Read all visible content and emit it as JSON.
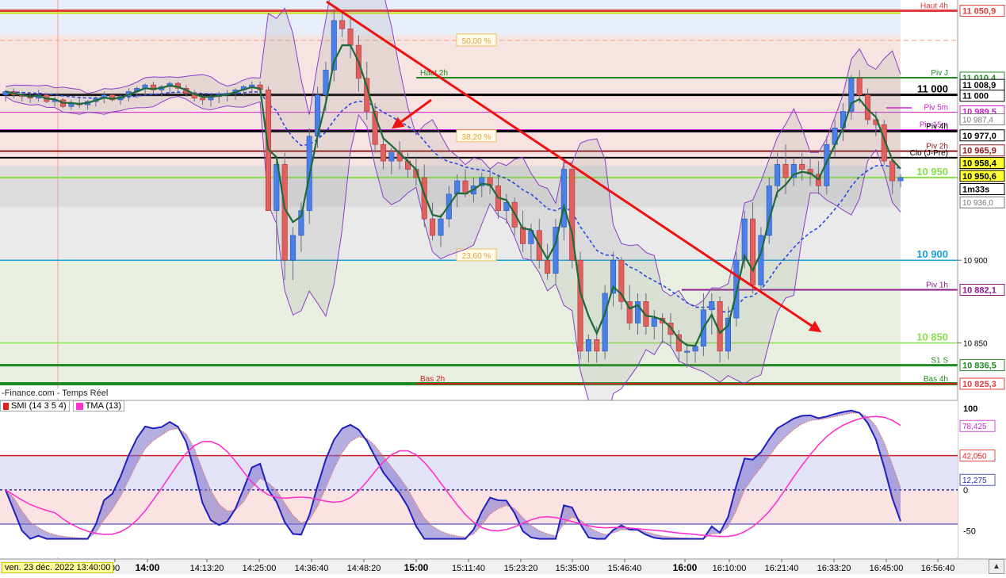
{
  "source_label": "-Finance.com - Temps Réel",
  "cursor_time": "ven. 23 déc. 2022 13:40:00",
  "price_axis_ticks": [
    {
      "value": 10900,
      "label": "10 900"
    },
    {
      "value": 10850,
      "label": "10 850"
    }
  ],
  "time_ticks": [
    {
      "label": "00",
      "bold": false
    },
    {
      "label": "14:00",
      "bold": true
    },
    {
      "label": "14:13:20",
      "bold": false
    },
    {
      "label": "14:25:00",
      "bold": false
    },
    {
      "label": "14:36:40",
      "bold": false
    },
    {
      "label": "14:48:20",
      "bold": false
    },
    {
      "label": "15:00",
      "bold": true
    },
    {
      "label": "15:11:40",
      "bold": false
    },
    {
      "label": "15:23:20",
      "bold": false
    },
    {
      "label": "15:35:00",
      "bold": false
    },
    {
      "label": "15:46:40",
      "bold": false
    },
    {
      "label": "16:00",
      "bold": true
    },
    {
      "label": "16:10:00",
      "bold": false
    },
    {
      "label": "16:21:40",
      "bold": false
    },
    {
      "label": "16:33:20",
      "bold": false
    },
    {
      "label": "16:45:00",
      "bold": false
    },
    {
      "label": "16:56:40",
      "bold": false
    }
  ],
  "levels": [
    {
      "name": "Haut 4h",
      "value": 11050.9,
      "badge": "11 050,9",
      "color": "#e23b3b",
      "inline": "Haut 4h"
    },
    {
      "name": "Piv J",
      "value": 11010.4,
      "badge": "11 010,4",
      "color": "#1f8a1f",
      "inline": "Piv J"
    },
    {
      "name": "Haut 2h",
      "value": 11010.4,
      "badge": "",
      "color": "#1f8a1f",
      "inline": "Haut 2h"
    },
    {
      "name": "11 000",
      "value": 11000,
      "badge": "11 000",
      "color": "#000000",
      "inline": "11 000"
    },
    {
      "name": "Piv 5m",
      "value": 10989.5,
      "badge": "10 989,5",
      "color": "#cc22cc",
      "inline": "Piv 5m"
    },
    {
      "name": "Piv 15m",
      "value": 10979.0,
      "badge": "",
      "color": "#cc22cc",
      "inline": "Piv 15m"
    },
    {
      "name": "Piv 4h",
      "value": 10978.0,
      "badge": "",
      "color": "#000000",
      "inline": "Piv 4h"
    },
    {
      "name": "Piv 2h",
      "value": 10966.0,
      "badge": "",
      "color": "#8b1a1a",
      "inline": "Piv 2h"
    },
    {
      "name": "Clo (J-Pre)",
      "value": 10962.0,
      "badge": "",
      "color": "#000000",
      "inline": "Clo (J-Pre)"
    },
    {
      "name": "10 950",
      "value": 10950,
      "badge": "",
      "color": "#88e04a",
      "inline": "10 950"
    },
    {
      "name": "10 900",
      "value": 10900,
      "badge": "",
      "color": "#19a0d8",
      "inline": "10 900"
    },
    {
      "name": "Piv 1h",
      "value": 10882.1,
      "badge": "10 882,1",
      "color": "#8b1a8b",
      "inline": "Piv 1h"
    },
    {
      "name": "10 850",
      "value": 10850,
      "badge": "",
      "color": "#88e04a",
      "inline": "10 850"
    },
    {
      "name": "S1 S",
      "value": 10836.5,
      "badge": "10 836,5",
      "color": "#1f8a1f",
      "inline": "S1 S"
    },
    {
      "name": "Bas 4h",
      "value": 10825.3,
      "badge": "10 825,3",
      "color": "#1f8a1f",
      "inline": "Bas 4h"
    },
    {
      "name": "Bas 2h",
      "value": 10825.3,
      "badge": "",
      "color": "#cc2222",
      "inline": "Bas 2h"
    }
  ],
  "price_badges": [
    {
      "label": "11 050,9",
      "value": 11050.9,
      "color": "#e23b3b"
    },
    {
      "label": "11 010,4",
      "value": 11010.4,
      "color": "#1f8a1f"
    },
    {
      "label": "11 008,9",
      "value": 11006.0,
      "color": "#000000"
    },
    {
      "label": "11 000",
      "value": 10999.5,
      "color": "#000000"
    },
    {
      "label": "10 989,5",
      "value": 10990.0,
      "color": "#cc22cc"
    },
    {
      "label": "10 987,4",
      "value": 10985.2,
      "color": "#777777"
    },
    {
      "label": "10 977,0",
      "value": 10975.5,
      "color": "#000000"
    },
    {
      "label": "10 965,9",
      "value": 10966.4,
      "color": "#8b1a1a"
    },
    {
      "label": "10 958,4",
      "value": 10958.8,
      "color": "#000000"
    },
    {
      "label": "10 950,6",
      "value": 10951.0,
      "color": "#000000"
    },
    {
      "label": "1m33s",
      "value": 10943.0,
      "color": "#000000"
    },
    {
      "label": "10 936,0",
      "value": 10935.0,
      "color": "#777777"
    },
    {
      "label": "10 882,1",
      "value": 10882.1,
      "color": "#8b1a8b"
    },
    {
      "label": "10 836,5",
      "value": 10836.5,
      "color": "#1f8a1f"
    },
    {
      "label": "10 825,3",
      "value": 10825.3,
      "color": "#e23b3b"
    }
  ],
  "fib_levels": [
    {
      "label": "50,00 %",
      "value": 11033
    },
    {
      "label": "38,20 %",
      "value": 10975
    },
    {
      "label": "23,60 %",
      "value": 10903
    }
  ],
  "indicator": {
    "smi_label": "SMI (14 3 5 4)",
    "tma_label": "TMA (13)",
    "smi_color": "#e02020",
    "tma_color": "#ff33cc",
    "ticks": [
      {
        "value": 100,
        "label": "100"
      },
      {
        "value": 0,
        "label": "0"
      },
      {
        "value": -50,
        "label": "-50"
      }
    ],
    "badges": [
      {
        "label": "78,425",
        "value": 78.4,
        "color": "#cc22cc"
      },
      {
        "label": "42,050",
        "value": 42.05,
        "color": "#e02020"
      },
      {
        "label": "12,275",
        "value": 12.3,
        "color": "#2030a0"
      }
    ],
    "upper_level": 42,
    "lower_level": -42
  },
  "chart_data": {
    "type": "candlestick",
    "title": "",
    "x_start": "13:40",
    "x_end": "17:00",
    "ylim": [
      10820,
      11055
    ],
    "candles": [
      [
        11000,
        11003,
        10996,
        11002
      ],
      [
        11002,
        11004,
        10998,
        11000
      ],
      [
        11000,
        11002,
        10996,
        10999
      ],
      [
        10999,
        11001,
        10995,
        10998
      ],
      [
        10998,
        11003,
        10996,
        11000
      ],
      [
        11000,
        11001,
        10995,
        10996
      ],
      [
        10996,
        10999,
        10993,
        10997
      ],
      [
        10997,
        10998,
        10992,
        10993
      ],
      [
        10993,
        10997,
        10991,
        10995
      ],
      [
        10995,
        10998,
        10992,
        10994
      ],
      [
        10994,
        10997,
        10991,
        10996
      ],
      [
        10996,
        10999,
        10993,
        10998
      ],
      [
        10998,
        11002,
        10995,
        11000
      ],
      [
        11000,
        11001,
        10996,
        10997
      ],
      [
        10997,
        11000,
        10994,
        10999
      ],
      [
        10999,
        11004,
        10996,
        11002
      ],
      [
        11002,
        11005,
        10998,
        11004
      ],
      [
        11004,
        11007,
        11000,
        11006
      ],
      [
        11006,
        11008,
        11001,
        11003
      ],
      [
        11003,
        11006,
        10999,
        11005
      ],
      [
        11005,
        11008,
        11001,
        11007
      ],
      [
        11007,
        11008,
        11002,
        11004
      ],
      [
        11004,
        11006,
        10999,
        11001
      ],
      [
        11001,
        11003,
        10996,
        10998
      ],
      [
        10998,
        11000,
        10994,
        10997
      ],
      [
        10997,
        11000,
        10993,
        10999
      ],
      [
        10999,
        11002,
        10995,
        11000
      ],
      [
        11000,
        11003,
        10996,
        11001
      ],
      [
        11001,
        11004,
        10997,
        11003
      ],
      [
        11003,
        11006,
        10999,
        11005
      ],
      [
        11005,
        11008,
        11001,
        11006
      ],
      [
        11006,
        11008,
        11001,
        11003
      ],
      [
        11003,
        11005,
        10960,
        10930
      ],
      [
        10930,
        10962,
        10900,
        10958
      ],
      [
        10958,
        10965,
        10888,
        10900
      ],
      [
        10900,
        10920,
        10888,
        10915
      ],
      [
        10915,
        10935,
        10905,
        10930
      ],
      [
        10930,
        10980,
        10922,
        10975
      ],
      [
        10975,
        11005,
        10968,
        11000
      ],
      [
        11000,
        11020,
        10990,
        11015
      ],
      [
        11015,
        11052,
        11008,
        11045
      ],
      [
        11045,
        11050,
        11035,
        11040
      ],
      [
        11040,
        11048,
        11022,
        11030
      ],
      [
        11030,
        11036,
        11002,
        11010
      ],
      [
        11010,
        11020,
        10985,
        10990
      ],
      [
        10990,
        10995,
        10965,
        10970
      ],
      [
        10970,
        10975,
        10955,
        10960
      ],
      [
        10960,
        10968,
        10952,
        10965
      ],
      [
        10965,
        10972,
        10955,
        10960
      ],
      [
        10960,
        10965,
        10950,
        10955
      ],
      [
        10955,
        10962,
        10945,
        10950
      ],
      [
        10950,
        10958,
        10920,
        10925
      ],
      [
        10925,
        10935,
        10912,
        10915
      ],
      [
        10915,
        10928,
        10908,
        10925
      ],
      [
        10925,
        10945,
        10920,
        10940
      ],
      [
        10940,
        10952,
        10932,
        10948
      ],
      [
        10948,
        10955,
        10938,
        10940
      ],
      [
        10940,
        10950,
        10935,
        10945
      ],
      [
        10945,
        10953,
        10938,
        10950
      ],
      [
        10950,
        10955,
        10940,
        10945
      ],
      [
        10945,
        10952,
        10925,
        10930
      ],
      [
        10930,
        10940,
        10922,
        10935
      ],
      [
        10935,
        10938,
        10915,
        10920
      ],
      [
        10920,
        10930,
        10905,
        10910
      ],
      [
        10910,
        10922,
        10900,
        10918
      ],
      [
        10918,
        10925,
        10895,
        10900
      ],
      [
        10900,
        10910,
        10888,
        10892
      ],
      [
        10892,
        10925,
        10885,
        10920
      ],
      [
        10920,
        10960,
        10912,
        10955
      ],
      [
        10955,
        10960,
        10895,
        10900
      ],
      [
        10900,
        10905,
        10840,
        10845
      ],
      [
        10845,
        10855,
        10838,
        10852
      ],
      [
        10852,
        10860,
        10838,
        10845
      ],
      [
        10845,
        10885,
        10840,
        10880
      ],
      [
        10880,
        10905,
        10872,
        10900
      ],
      [
        10900,
        10902,
        10870,
        10875
      ],
      [
        10875,
        10885,
        10858,
        10862
      ],
      [
        10862,
        10880,
        10855,
        10875
      ],
      [
        10875,
        10880,
        10855,
        10860
      ],
      [
        10860,
        10870,
        10852,
        10865
      ],
      [
        10865,
        10868,
        10850,
        10862
      ],
      [
        10862,
        10868,
        10848,
        10855
      ],
      [
        10855,
        10858,
        10838,
        10845
      ],
      [
        10845,
        10850,
        10835,
        10845
      ],
      [
        10845,
        10850,
        10838,
        10848
      ],
      [
        10848,
        10880,
        10842,
        10870
      ],
      [
        10870,
        10880,
        10855,
        10875
      ],
      [
        10875,
        10878,
        10838,
        10845
      ],
      [
        10845,
        10872,
        10840,
        10865
      ],
      [
        10865,
        10905,
        10860,
        10900
      ],
      [
        10900,
        10930,
        10895,
        10925
      ],
      [
        10925,
        10935,
        10880,
        10885
      ],
      [
        10885,
        10920,
        10880,
        10915
      ],
      [
        10915,
        10950,
        10910,
        10945
      ],
      [
        10945,
        10965,
        10938,
        10958
      ],
      [
        10958,
        10970,
        10940,
        10950
      ],
      [
        10950,
        10962,
        10945,
        10958
      ],
      [
        10958,
        10965,
        10948,
        10955
      ],
      [
        10955,
        10962,
        10945,
        10952
      ],
      [
        10952,
        10960,
        10940,
        10945
      ],
      [
        10945,
        10975,
        10940,
        10970
      ],
      [
        10970,
        10985,
        10962,
        10980
      ],
      [
        10980,
        10995,
        10972,
        10990
      ],
      [
        10990,
        11012,
        10985,
        11010
      ],
      [
        11010,
        11015,
        10995,
        11000
      ],
      [
        11000,
        11004,
        10982,
        10985
      ],
      [
        10985,
        10990,
        10975,
        10982
      ],
      [
        10982,
        10985,
        10958,
        10960
      ],
      [
        10960,
        10962,
        10940,
        10948
      ],
      [
        10948,
        10952,
        10944,
        10950
      ]
    ]
  }
}
